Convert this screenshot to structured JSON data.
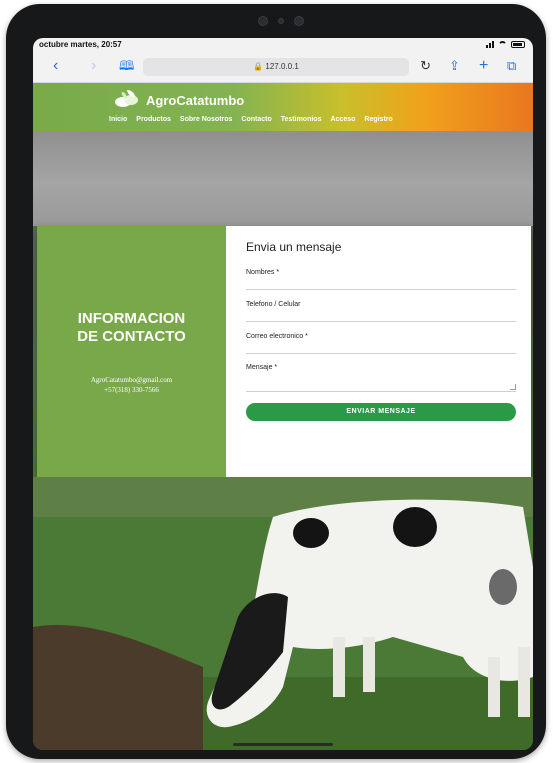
{
  "status_bar": {
    "time": "octubre martes, 20:57"
  },
  "browser": {
    "text_size_label": "AA",
    "address": "127.0.0.1"
  },
  "site": {
    "brand": "AgroCatatumbo",
    "nav": [
      "Inicio",
      "Productos",
      "Sobre Nosotros",
      "Contacto",
      "Testimonios",
      "Acceso",
      "Registro"
    ]
  },
  "contact_info": {
    "title_line1": "INFORMACION",
    "title_line2": "DE CONTACTO",
    "email": "AgroCatatumbo@gmail.com",
    "phone": "+57(318) 330-7566"
  },
  "form": {
    "title": "Envia un mensaje",
    "name_label": "Nombres *",
    "phone_label": "Telefono / Celular",
    "email_label": "Correo electronico *",
    "message_label": "Mensaje *",
    "submit_label": "ENVIAR MENSAJE"
  },
  "colors": {
    "accent_green": "#79a84a",
    "button_green": "#2a9a46",
    "header_orange": "#e9771f",
    "link_blue": "#1a73e8"
  }
}
